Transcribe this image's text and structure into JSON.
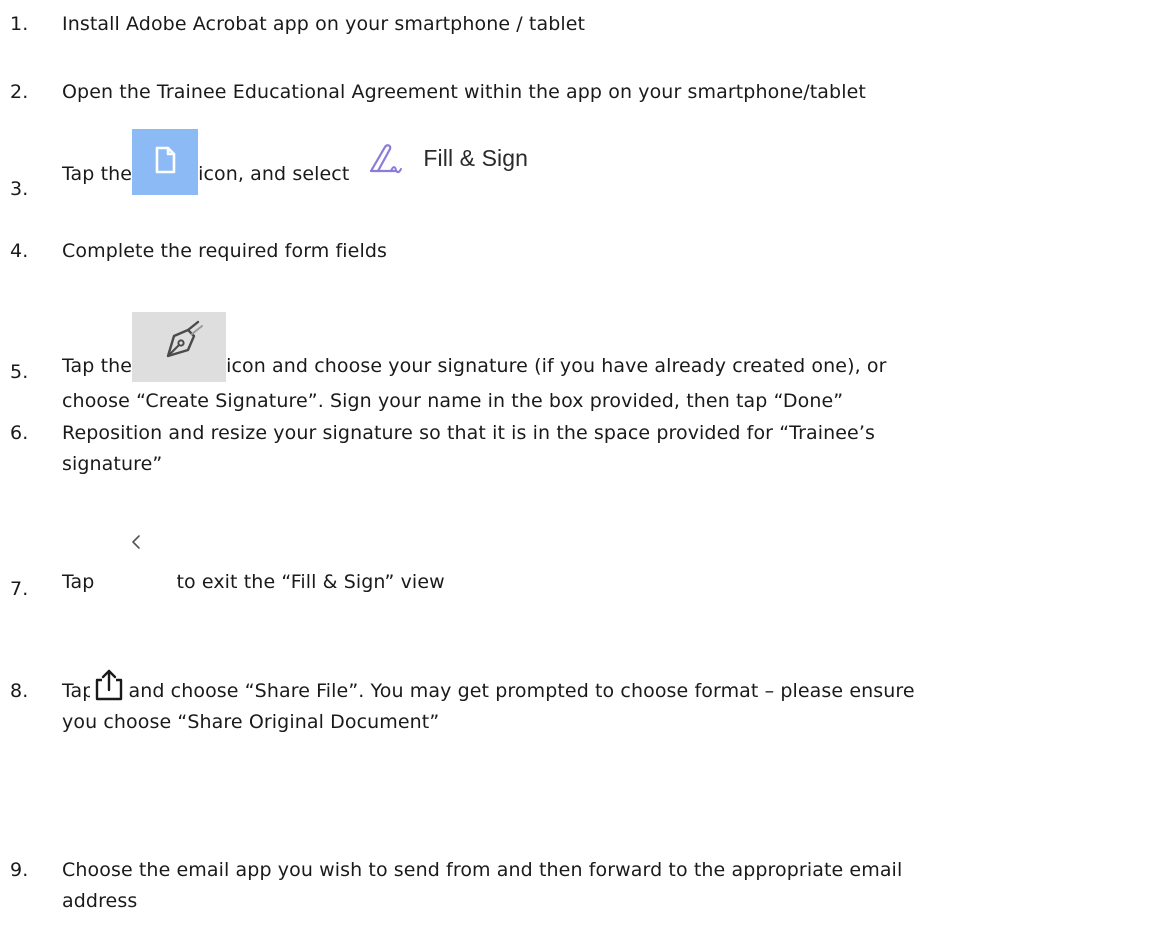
{
  "steps": [
    {
      "num": "1.",
      "text": "Install Adobe Acrobat app on your smartphone / tablet"
    },
    {
      "num": "2.",
      "text": "Open the Trainee Educational Agreement within the app on your smartphone/tablet"
    },
    {
      "num": "3.",
      "text_before": "Tap the ",
      "text_mid": " icon, and select",
      "fill_sign_label": "Fill & Sign"
    },
    {
      "num": "4.",
      "text": "Complete the required form fields"
    },
    {
      "num": "5.",
      "text_before": "Tap the ",
      "text_after": " icon and choose your signature (if you have already created one), or",
      "line2": "choose “Create Signature”.  Sign your name in the box provided, then tap “Done”"
    },
    {
      "num": "6.",
      "line1": "Reposition and resize your signature so that it is in the space provided for “Trainee’s",
      "line2": "signature”"
    },
    {
      "num": "7.",
      "text_before": "Tap ",
      "text_after": " to exit the “Fill & Sign” view"
    },
    {
      "num": "8.",
      "text_before": "Tap ",
      "text_after": " and choose “Share File”.  You may get prompted to choose format – please ensure",
      "line2": "you choose “Share Original Document”"
    },
    {
      "num": "9.",
      "line1": "Choose the email app you wish to send from and then forward to the appropriate email",
      "line2": "address"
    }
  ],
  "icons": {
    "document_tile": "document-icon",
    "fill_sign": "fill-sign-pen-icon",
    "signature": "pen-nib-icon",
    "back": "chevron-left-icon",
    "share": "share-icon"
  },
  "colors": {
    "document_tile_bg": "#8cbaf4",
    "signature_tile_bg": "#dedede",
    "fill_sign_icon": "#8a7cd8"
  }
}
